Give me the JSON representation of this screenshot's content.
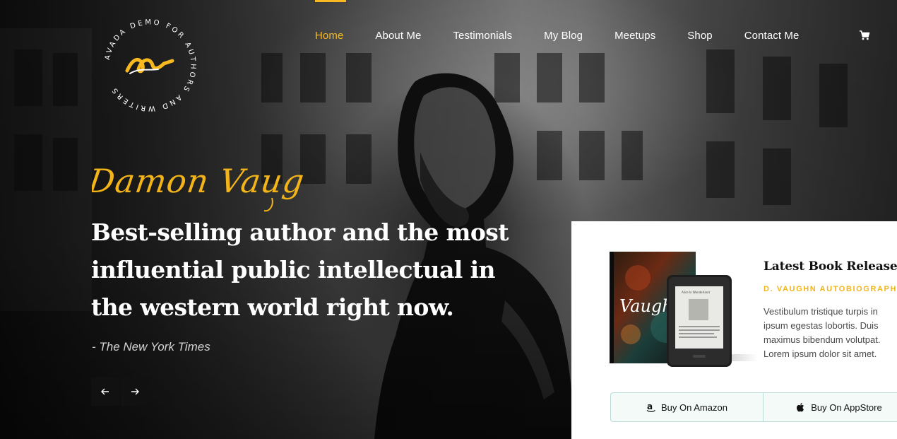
{
  "logo": {
    "ring_text": "AVADA DEMO FOR AUTHORS AND WRITERS"
  },
  "nav": {
    "items": [
      {
        "label": "Home",
        "active": true
      },
      {
        "label": "About Me"
      },
      {
        "label": "Testimonials"
      },
      {
        "label": "My Blog"
      },
      {
        "label": "Meetups"
      },
      {
        "label": "Shop"
      },
      {
        "label": "Contact Me"
      }
    ],
    "cart_icon": "cart-icon"
  },
  "hero": {
    "signature": "Damon Vaughn",
    "headline": "Best-selling author and the most influential public intellectual in the western world right now.",
    "source": "- The New York Times",
    "prev_icon": "arrow-left-icon",
    "next_icon": "arrow-right-icon"
  },
  "book": {
    "title": "Latest Book Release",
    "subtitle": "D. VAUGHN AUTOBIOGRAPHY",
    "description": "Vestibulum tristique turpis in ipsum egestas lobortis. Duis maximus bibendum volutpat. Lorem ipsum dolor sit amet.",
    "cover_text": "Vaughn",
    "ereader_text": "Alice In Wonderland",
    "buy_amazon": "Buy On Amazon",
    "buy_appstore": "Buy On AppStore"
  },
  "colors": {
    "accent": "#f7b91f",
    "panel_bg": "#ffffff",
    "button_border": "#b9ddd6"
  }
}
